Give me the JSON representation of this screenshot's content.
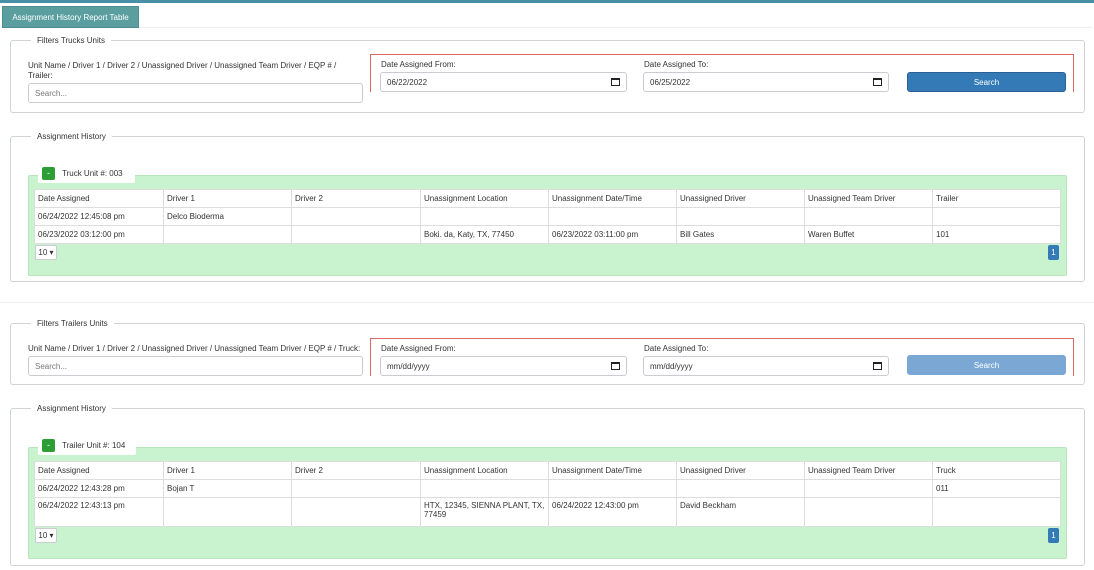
{
  "header": {
    "tab_label": "Assignment History Report Table"
  },
  "truck_filters": {
    "legend": "Filters Trucks Units",
    "search_label": "Unit Name / Driver 1 / Driver 2 / Unassigned Driver / Unassigned Team Driver / EQP # / Trailer:",
    "search_placeholder": "Search...",
    "date_from_label": "Date Assigned From:",
    "date_from_value": "06/22/2022",
    "date_to_label": "Date Assigned To:",
    "date_to_value": "06/25/2022",
    "search_button": "Search"
  },
  "truck_history": {
    "legend": "Assignment History",
    "unit_toggle": "-",
    "unit_label": "Truck Unit #: 003",
    "columns": [
      "Date Assigned",
      "Driver 1",
      "Driver 2",
      "Unassignment Location",
      "Unassignment Date/Time",
      "Unassigned Driver",
      "Unassigned Team Driver",
      "Trailer"
    ],
    "rows": [
      [
        "06/24/2022 12:45:08 pm",
        "Delco Bioderma",
        "",
        "",
        "",
        "",
        "",
        ""
      ],
      [
        "06/23/2022 03:12:00 pm",
        "",
        "",
        "Boki. da, Katy, TX, 77450",
        "06/23/2022 03:11:00 pm",
        "Bill Gates",
        "Waren Buffet",
        "101"
      ]
    ],
    "page_size": "10 ▾",
    "current_page": "1"
  },
  "trailer_filters": {
    "legend": "Filters Trailers Units",
    "search_label": "Unit Name / Driver 1 / Driver 2 / Unassigned Driver / Unassigned Team Driver / EQP # / Truck:",
    "search_placeholder": "Search...",
    "date_from_label": "Date Assigned From:",
    "date_from_value": "mm/dd/yyyy",
    "date_to_label": "Date Assigned To:",
    "date_to_value": "mm/dd/yyyy",
    "search_button": "Search"
  },
  "trailer_history": {
    "legend": "Assignment History",
    "unit_toggle": "-",
    "unit_label": "Trailer Unit #: 104",
    "columns": [
      "Date Assigned",
      "Driver 1",
      "Driver 2",
      "Unassignment Location",
      "Unassignment Date/Time",
      "Unassigned Driver",
      "Unassigned Team Driver",
      "Truck"
    ],
    "rows": [
      [
        "06/24/2022 12:43:28 pm",
        "Bojan T",
        "",
        "",
        "",
        "",
        "",
        "011"
      ],
      [
        "06/24/2022 12:43:13 pm",
        "",
        "",
        "HTX, 12345, SIENNA PLANT, TX, 77459",
        "06/24/2022 12:43:00 pm",
        "David Beckham",
        "",
        ""
      ]
    ],
    "page_size": "10 ▾",
    "current_page": "1"
  },
  "colors": {
    "accent_bar": "#4a8fa8",
    "tab_bg": "#5a9ea0",
    "panel_green": "#c9f3cf",
    "toggle_green": "#2c9e35",
    "primary_button": "#337ab7",
    "disabled_button": "#7aa7d4",
    "date_frame_red": "#e06666"
  }
}
